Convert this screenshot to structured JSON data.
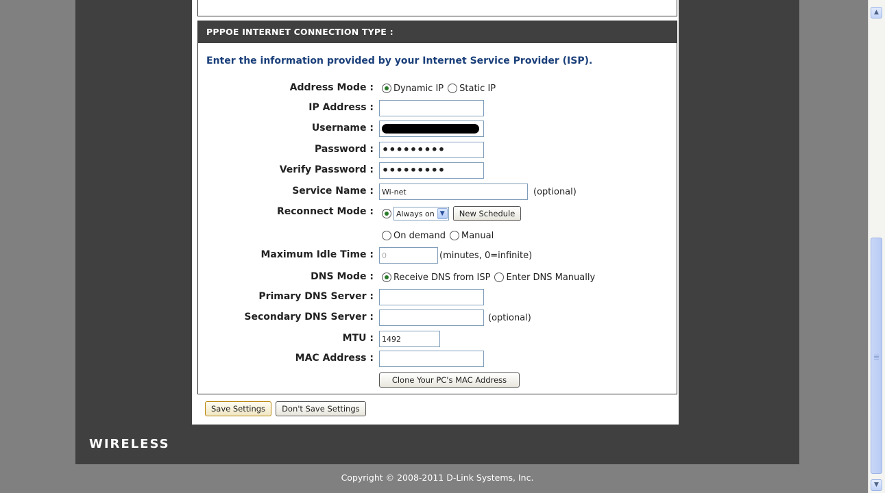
{
  "section": {
    "title": "PPPOE INTERNET CONNECTION TYPE :",
    "intro": "Enter the information provided by your Internet Service Provider (ISP)."
  },
  "fields": {
    "address_mode": {
      "label": "Address Mode :",
      "options": [
        "Dynamic IP",
        "Static IP"
      ],
      "selected": "Dynamic IP"
    },
    "ip_address": {
      "label": "IP Address :",
      "value": ""
    },
    "username": {
      "label": "Username :",
      "value": "[redacted]"
    },
    "password": {
      "label": "Password :",
      "value": "•••••••••"
    },
    "verify_password": {
      "label": "Verify Password :",
      "value": "•••••••••"
    },
    "service_name": {
      "label": "Service Name :",
      "value": "Wi-net",
      "note": "(optional)"
    },
    "reconnect_mode": {
      "label": "Reconnect Mode :",
      "schedule_value": "Always on",
      "new_schedule_label": "New Schedule",
      "option_on_demand": "On demand",
      "option_manual": "Manual",
      "selected": "schedule"
    },
    "max_idle_time": {
      "label": "Maximum Idle Time :",
      "value": "0",
      "note": "(minutes, 0=infinite)"
    },
    "dns_mode": {
      "label": "DNS Mode :",
      "options": [
        "Receive DNS from ISP",
        "Enter DNS Manually"
      ],
      "selected": "Receive DNS from ISP"
    },
    "primary_dns": {
      "label": "Primary DNS Server :",
      "value": ""
    },
    "secondary_dns": {
      "label": "Secondary DNS Server :",
      "value": "",
      "note": "(optional)"
    },
    "mtu": {
      "label": "MTU :",
      "value": "1492"
    },
    "mac_address": {
      "label": "MAC Address :",
      "value": ""
    },
    "clone_mac_label": "Clone Your PC's MAC Address"
  },
  "actions": {
    "save_label": "Save Settings",
    "dont_save_label": "Don't Save Settings"
  },
  "footer": {
    "logo_text": "WIRELESS",
    "copyright": "Copyright © 2008-2011 D-Link Systems, Inc."
  },
  "colors": {
    "panel": "#404040",
    "page_bg": "#808080",
    "intro_text": "#1a3f7a"
  }
}
